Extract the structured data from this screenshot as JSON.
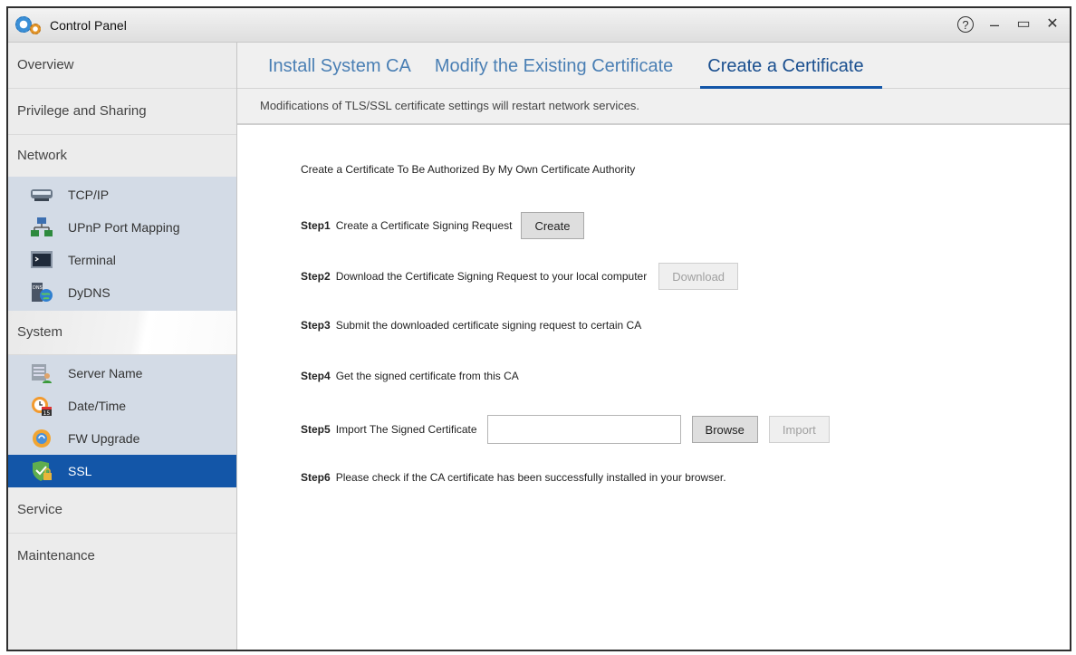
{
  "window": {
    "title": "Control Panel",
    "controls": {
      "help": "?",
      "minimize": "–",
      "maximize": "▭",
      "close": "✕"
    }
  },
  "sidebar": {
    "overview": "Overview",
    "privilege": "Privilege and Sharing",
    "network": "Network",
    "network_items": [
      "TCP/IP",
      "UPnP Port Mapping",
      "Terminal",
      "DyDNS"
    ],
    "system": "System",
    "system_items": [
      "Server Name",
      "Date/Time",
      "FW Upgrade",
      "SSL"
    ],
    "service": "Service",
    "maintenance": "Maintenance"
  },
  "tabs": [
    "Install System CA",
    "Modify the Existing Certificate",
    "Create a Certificate"
  ],
  "active_tab": "Create a Certificate",
  "notice": "Modifications of TLS/SSL certificate settings will restart network services.",
  "content": {
    "heading": "Create a Certificate To Be Authorized By My Own Certificate Authority",
    "steps": [
      {
        "label": "Step1",
        "text": "Create a Certificate Signing Request",
        "button": "Create"
      },
      {
        "label": "Step2",
        "text": "Download the Certificate Signing Request to your local computer",
        "button": "Download"
      },
      {
        "label": "Step3",
        "text": "Submit the downloaded certificate signing request to certain CA"
      },
      {
        "label": "Step4",
        "text": "Get the signed certificate from this CA"
      },
      {
        "label": "Step5",
        "text": "Import The Signed Certificate",
        "browse": "Browse",
        "import": "Import",
        "file_value": ""
      },
      {
        "label": "Step6",
        "text": "Please check if the CA certificate has been successfully installed in your browser."
      }
    ]
  },
  "colors": {
    "accent": "#1356a8",
    "tab_text": "#4a7fb4",
    "sidebar_group": "#d3dbe6"
  }
}
